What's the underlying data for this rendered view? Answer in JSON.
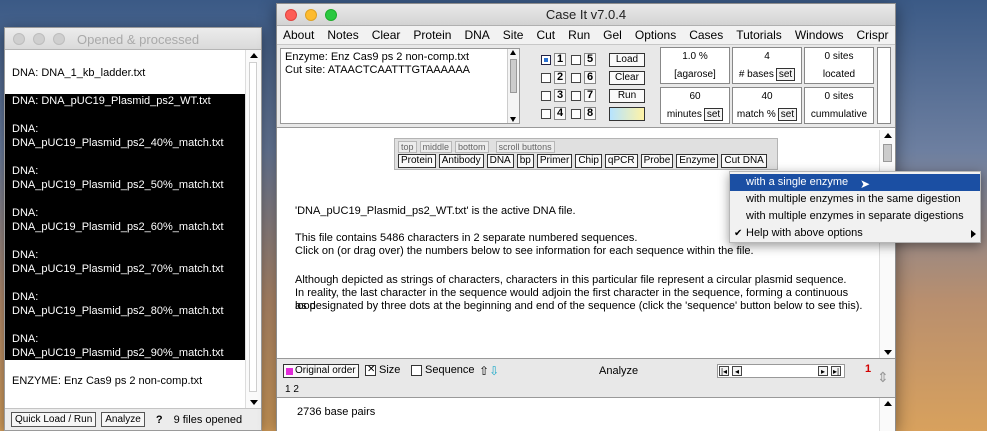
{
  "left_window": {
    "title": "Opened & processed",
    "entries": [
      {
        "text": "DNA: DNA_1_kb_ladder.txt",
        "selected": false
      },
      {
        "text": "DNA: DNA_pUC19_Plasmid_ps2_WT.txt",
        "selected": true
      },
      {
        "text": "DNA:",
        "selected": true
      },
      {
        "text": "DNA_pUC19_Plasmid_ps2_40%_match.txt",
        "selected": true
      },
      {
        "text": "DNA:",
        "selected": true
      },
      {
        "text": "DNA_pUC19_Plasmid_ps2_50%_match.txt",
        "selected": true
      },
      {
        "text": "DNA:",
        "selected": true
      },
      {
        "text": "DNA_pUC19_Plasmid_ps2_60%_match.txt",
        "selected": true
      },
      {
        "text": "DNA:",
        "selected": true
      },
      {
        "text": "DNA_pUC19_Plasmid_ps2_70%_match.txt",
        "selected": true
      },
      {
        "text": "DNA:",
        "selected": true
      },
      {
        "text": "DNA_pUC19_Plasmid_ps2_80%_match.txt",
        "selected": true
      },
      {
        "text": "DNA:",
        "selected": true
      },
      {
        "text": "DNA_pUC19_Plasmid_ps2_90%_match.txt",
        "selected": true
      },
      {
        "text": "ENZYME: Enz Cas9 ps 2 non-comp.txt",
        "selected": false
      }
    ],
    "bottom": {
      "quick_load": "Quick Load / Run",
      "analyze": "Analyze",
      "help": "?",
      "files_opened": "9  files opened"
    }
  },
  "main_window": {
    "title": "Case It v7.0.4",
    "menu": [
      "About",
      "Notes",
      "Clear",
      "Protein",
      "DNA",
      "Site",
      "Cut",
      "Run",
      "Gel",
      "Options",
      "Cases",
      "Tutorials",
      "Windows",
      "Crispr"
    ],
    "enzyme_line": "Enzyme: Enz Cas9 ps 2 non-comp.txt",
    "cutsite_line": "Cut site: ATAACTCAATTTGTAAAAAA",
    "lanes": [
      "1",
      "5",
      "2",
      "6",
      "3",
      "7",
      "4",
      "8"
    ],
    "load_label": "Load",
    "clear_label": "Clear",
    "run_label": "Run",
    "cells": {
      "agarose_value": "1.0  %",
      "agarose_label": "[agarose]",
      "bases_value": "4",
      "bases_label": "# bases",
      "set_label": "set",
      "sites_value": "0  sites",
      "sites_label": "located",
      "minutes_value": "60",
      "minutes_label": "minutes",
      "match_value": "40",
      "match_label": "match %",
      "cum_value": "0  sites",
      "cum_label": "cummulative"
    },
    "scroll_tabs": [
      "top",
      "middle",
      "bottom",
      "scroll buttons"
    ],
    "tool_buttons": [
      "Protein",
      "Antibody",
      "DNA",
      "bp",
      "Primer",
      "Chip",
      "qPCR",
      "Probe",
      "Enzyme",
      "Cut DNA"
    ],
    "paragraphs": {
      "p1": "'DNA_pUC19_Plasmid_ps2_WT.txt' is the active DNA file.",
      "p2a": "This file contains 5486 characters in 2 separate numbered sequences.",
      "p2b": "Click on (or drag over) the numbers below to see information for each sequence within the file.",
      "p3a": "Although depicted as strings of characters, characters in this particular file represent a circular plasmid sequence.",
      "p3b": "In reality, the last character in the sequence would adjoin the first character in the sequence, forming a continuous loop",
      "p3c": "as designated  by three dots at the beginning and end of the sequence (click the 'sequence' button below to see this)."
    },
    "dropdown": {
      "items": [
        {
          "label": "with a single enzyme",
          "active": true
        },
        {
          "label": "with multiple enzymes in the same digestion",
          "active": false
        },
        {
          "label": "with multiple enzymes in separate digestions",
          "active": false
        },
        {
          "label": "Help with above options",
          "active": false
        }
      ]
    },
    "status": {
      "original_order": "Original order",
      "size": "Size",
      "sequence": "Sequence",
      "analyze": "Analyze",
      "red_number": "1",
      "sequence_numbers": "1  2"
    },
    "base_pairs": "2736 base pairs"
  },
  "colors": {
    "traffic_red": "#fd5d56",
    "traffic_yellow": "#fdbb2f",
    "traffic_green": "#2ac840",
    "selection": "#000000",
    "menu_highlight": "#1b4fa3"
  }
}
